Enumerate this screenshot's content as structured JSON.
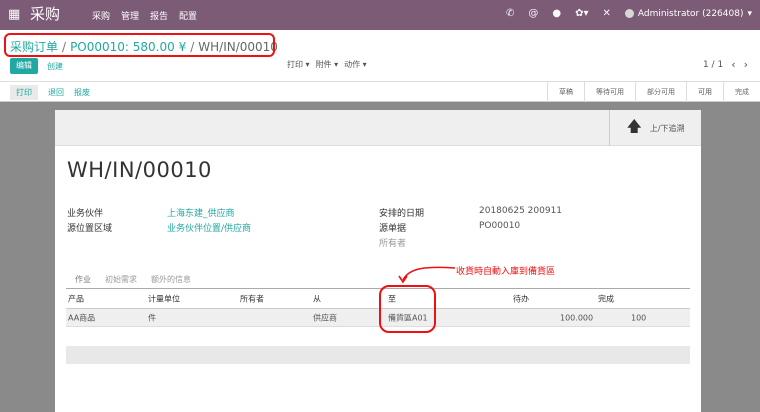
{
  "navbar": {
    "app_name": "采购",
    "menu": [
      "采购",
      "管理",
      "报告",
      "配置"
    ],
    "user": "Administrator (226408)",
    "user_caret": "▾",
    "icons": [
      "phone-icon",
      "at-icon",
      "chat-icon",
      "bug-icon",
      "cross-tools-icon"
    ]
  },
  "breadcrumb": {
    "items": [
      "采购订单",
      "PO00010: 580.00 ¥",
      "WH/IN/00010"
    ]
  },
  "control": {
    "edit_label": "编辑",
    "create_label": "创建",
    "print_label": "打印 ▾",
    "attach_label": "附件 ▾",
    "action_label": "动作 ▾",
    "pager": "1 / 1"
  },
  "statusbar": {
    "buttons": [
      "打印",
      "退回",
      "报废"
    ],
    "stages": [
      "草稿",
      "等待可用",
      "部分可用",
      "可用",
      "完成"
    ]
  },
  "sheet": {
    "up_down_label": "上/下追溯",
    "title": "WH/IN/00010",
    "left_fields": [
      {
        "label": "业务伙伴",
        "value": "上海东建_供应商"
      },
      {
        "label": "源位置区域",
        "value": "业务伙伴位置/供应商"
      }
    ],
    "right_fields": [
      {
        "label": "安排的日期",
        "value": "20180625 200911"
      },
      {
        "label": "源单据",
        "value": "PO00010"
      },
      {
        "label": "所有者",
        "value": ""
      }
    ],
    "tabs": [
      "作业",
      "初始需求",
      "额外的信息"
    ],
    "table": {
      "headers": [
        "产品",
        "计量单位",
        "所有者",
        "从",
        "至",
        "待办",
        "完成"
      ],
      "rows": [
        [
          "AA商品",
          "件",
          "",
          "供应商",
          "備貨區A01",
          "100.000",
          "100"
        ]
      ]
    }
  },
  "annotation": {
    "note": "收貨時自動入庫到備貨區",
    "color": "#ee1111"
  },
  "colors": {
    "navbar": "#7c5b77",
    "accent": "#21a8a3"
  }
}
